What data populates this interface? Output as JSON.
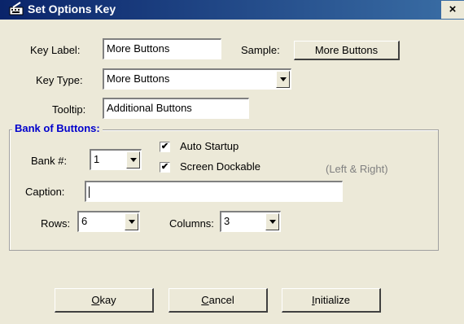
{
  "window": {
    "title": "Set Options Key",
    "close_glyph": "×"
  },
  "key_label": {
    "label": "Key Label:",
    "value": "More Buttons"
  },
  "sample": {
    "label": "Sample:",
    "button_text": "More Buttons"
  },
  "key_type": {
    "label": "Key Type:",
    "selected": "More Buttons"
  },
  "tooltip": {
    "label": "Tooltip:",
    "value": "Additional Buttons"
  },
  "bank_group": {
    "title": "Bank of Buttons:",
    "bank_label": "Bank #:",
    "bank_value": "1",
    "auto_startup_label": "Auto Startup",
    "auto_startup_checked": true,
    "screen_dockable_label": "Screen Dockable",
    "screen_dockable_checked": true,
    "dock_hint": "(Left & Right)",
    "caption_label": "Caption:",
    "caption_value": "",
    "rows_label": "Rows:",
    "rows_value": "6",
    "columns_label": "Columns:",
    "columns_value": "3"
  },
  "buttons": {
    "okay_mnemonic": "O",
    "okay_rest": "kay",
    "cancel_mnemonic": "C",
    "cancel_rest": "ancel",
    "initialize_mnemonic": "I",
    "initialize_rest": "nitialize"
  },
  "check_glyph": "✔"
}
